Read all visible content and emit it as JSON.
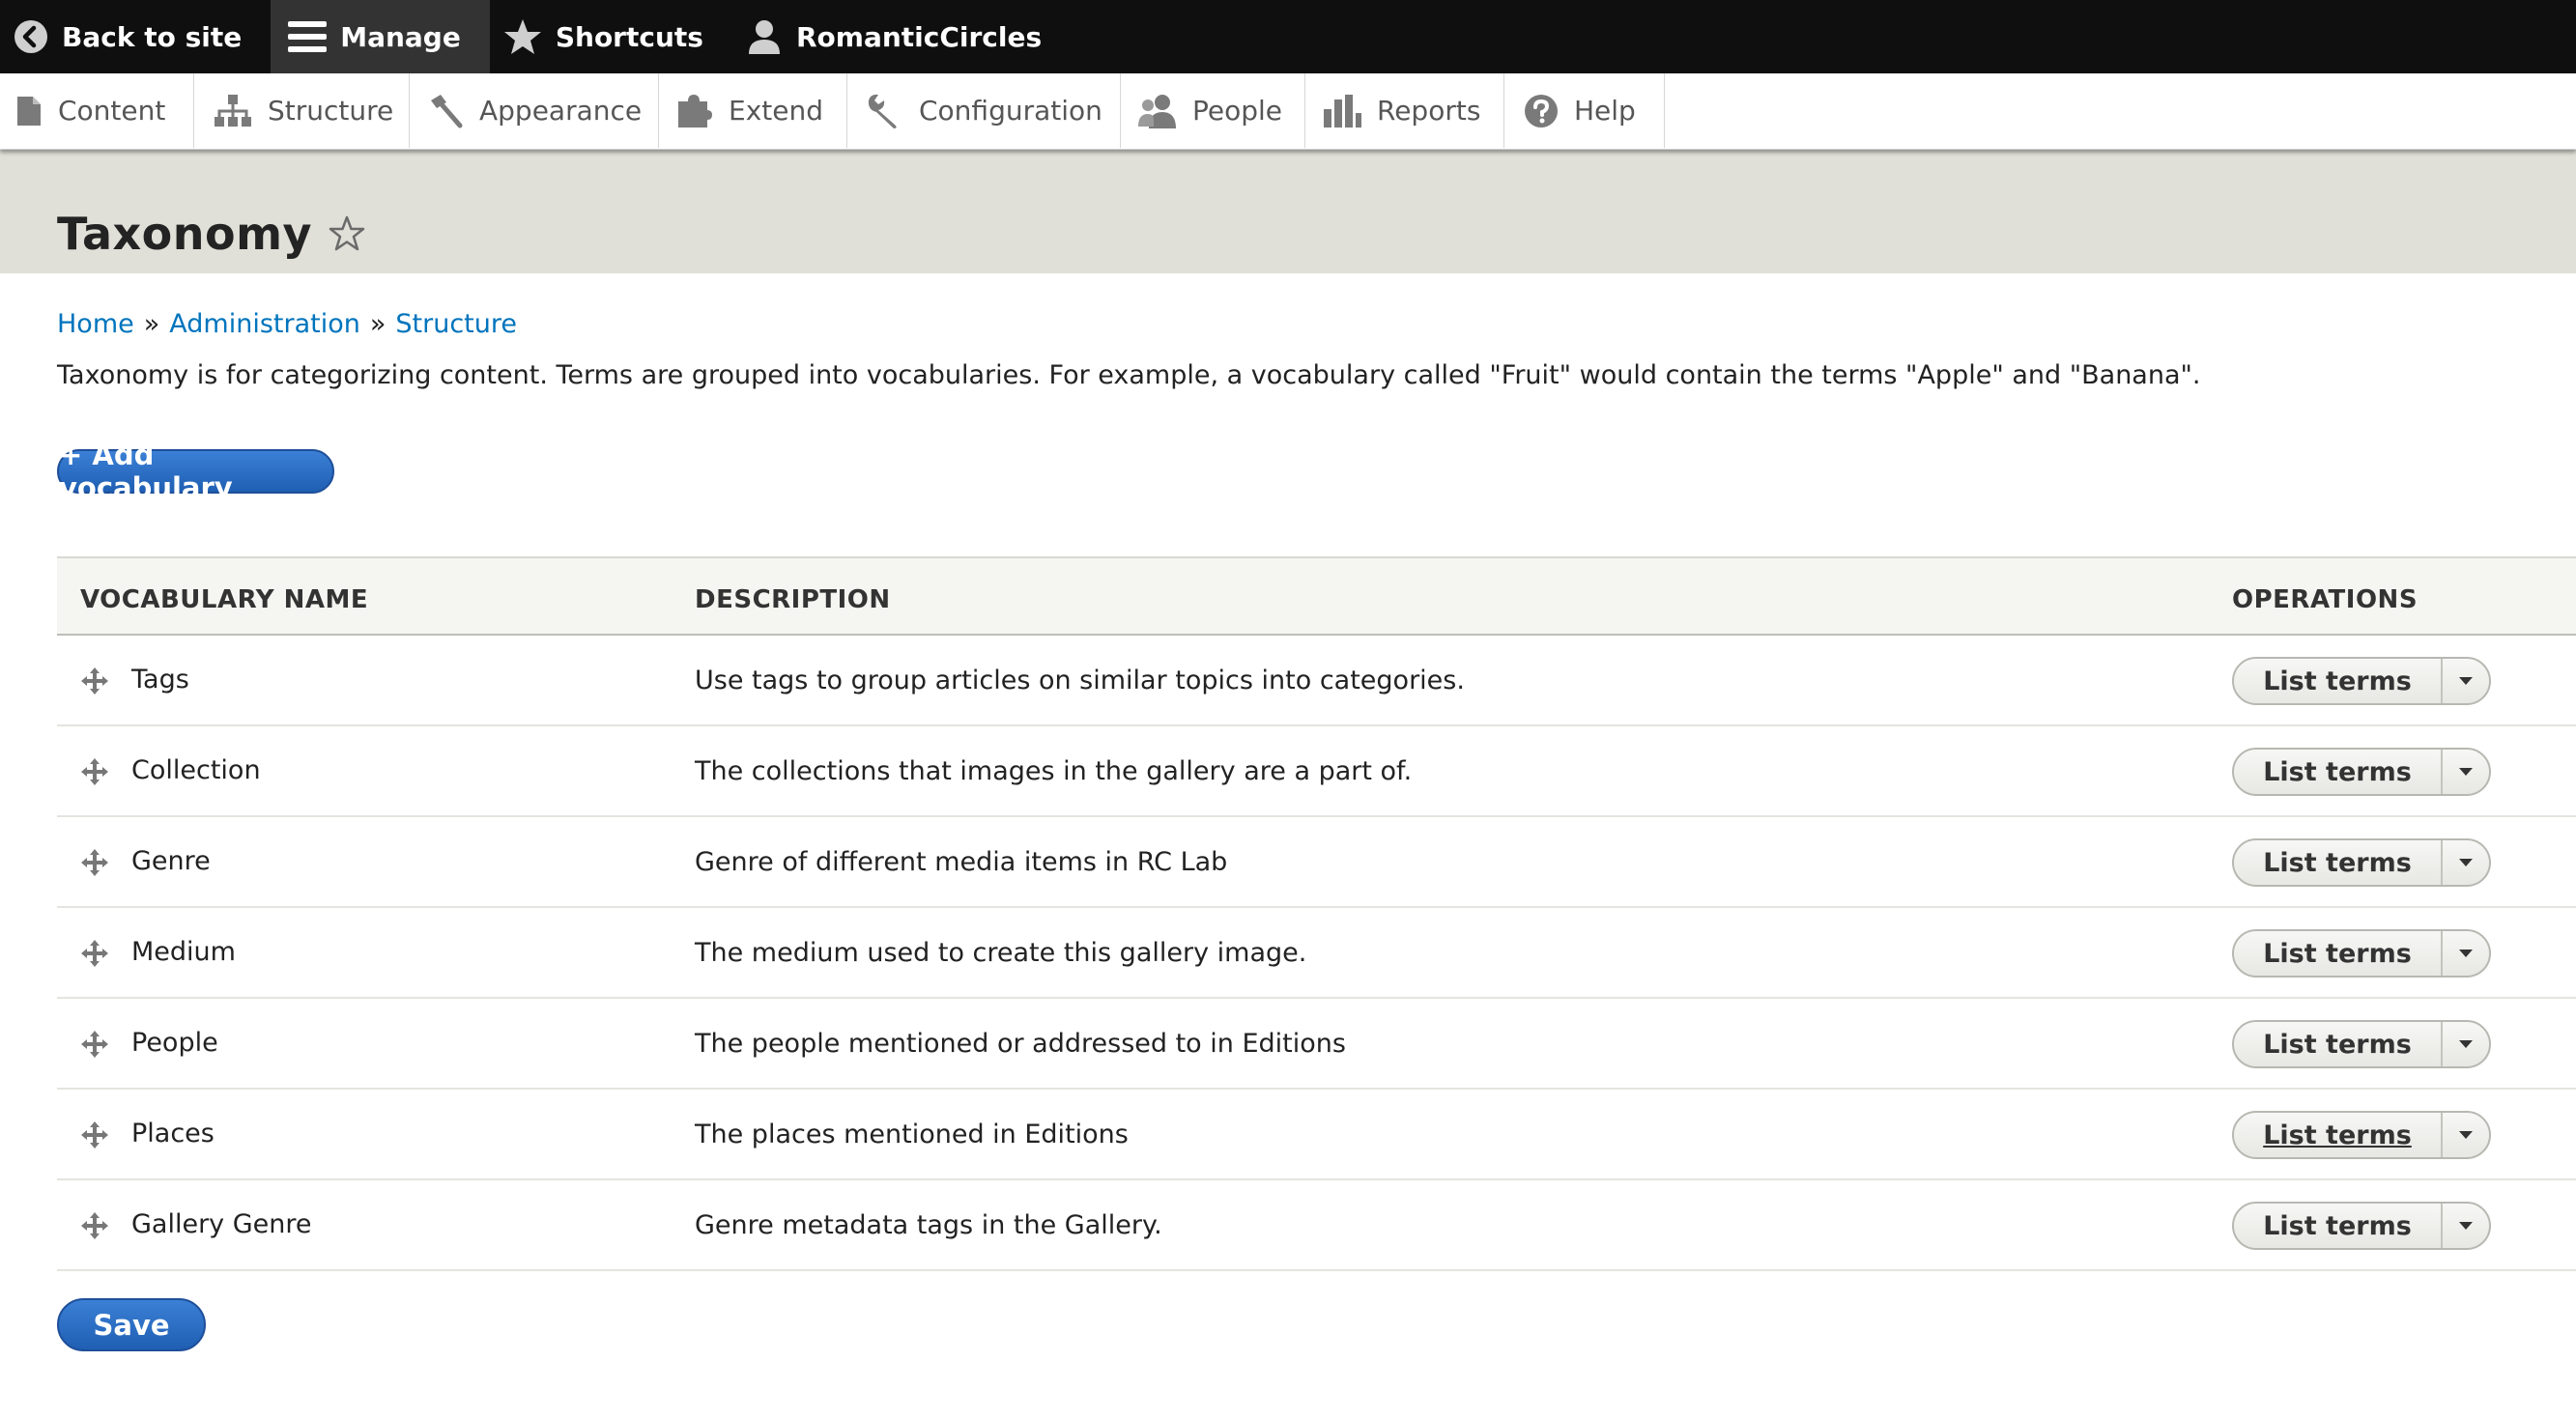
{
  "toolbar": {
    "back_to_site": "Back to site",
    "manage": "Manage",
    "shortcuts": "Shortcuts",
    "user": "RomanticCircles"
  },
  "tray": {
    "content": "Content",
    "structure": "Structure",
    "appearance": "Appearance",
    "extend": "Extend",
    "configuration": "Configuration",
    "people": "People",
    "reports": "Reports",
    "help": "Help"
  },
  "page": {
    "title": "Taxonomy",
    "breadcrumb": [
      "Home",
      "Administration",
      "Structure"
    ],
    "breadcrumb_separator": "»",
    "help_text": "Taxonomy is for categorizing content. Terms are grouped into vocabularies. For example, a vocabulary called \"Fruit\" would contain the terms \"Apple\" and \"Banana\".",
    "add_vocabulary_label": "+ Add vocabulary",
    "save_label": "Save"
  },
  "table": {
    "headers": [
      "VOCABULARY NAME",
      "DESCRIPTION",
      "OPERATIONS"
    ],
    "operation_label": "List terms",
    "rows": [
      {
        "name": "Tags",
        "description": "Use tags to group articles on similar topics into categories."
      },
      {
        "name": "Collection",
        "description": "The collections that images in the gallery are a part of."
      },
      {
        "name": "Genre",
        "description": "Genre of different media items in RC Lab"
      },
      {
        "name": "Medium",
        "description": "The medium used to create this gallery image."
      },
      {
        "name": "People",
        "description": "The people mentioned or addressed to in Editions"
      },
      {
        "name": "Places",
        "description": "The places mentioned in Editions"
      },
      {
        "name": "Gallery Genre",
        "description": "Genre metadata tags in the Gallery."
      }
    ]
  },
  "colors": {
    "toolbar_bg": "#0f0f0f",
    "header_band": "#e0e0d8",
    "link": "#0074bd",
    "primary_button": "#2369c2"
  }
}
